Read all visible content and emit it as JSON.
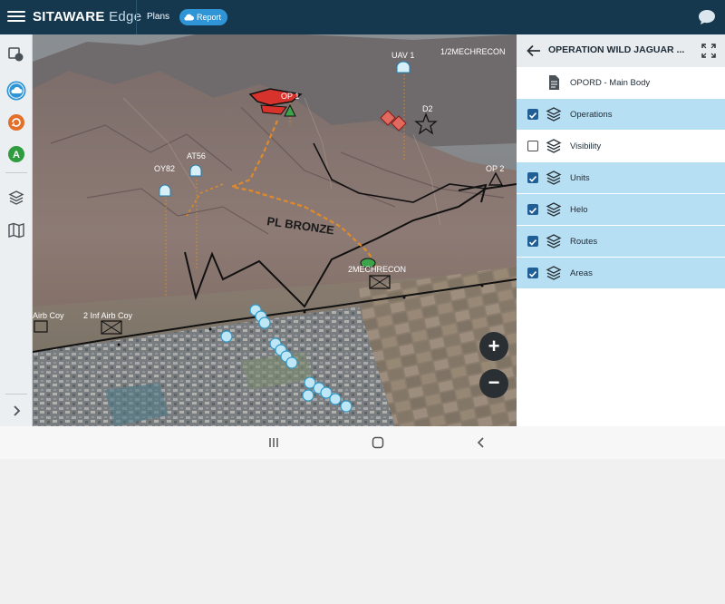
{
  "header": {
    "brand_bold": "SITAWARE",
    "brand_light": " Edge",
    "plans_label": "Plans",
    "report_label": "Report"
  },
  "leftbar": {
    "icons": [
      "layers-shapes-icon",
      "cloud-icon",
      "refresh-orange-icon",
      "letter-a-green-icon",
      "layers-icon",
      "map-book-icon",
      "chevron-right-icon"
    ],
    "badge_a": "A"
  },
  "map": {
    "labels": {
      "uav1": "UAV 1",
      "mechrecon_top": "1/2MECHRECON",
      "op1": "OP 1",
      "d2": "D2",
      "at56": "AT56",
      "oy82": "OY82",
      "op2": "OP 2",
      "pl_bronze": "PL BRONZE",
      "mechrecon_mid": "2MECHRECON",
      "airb_coy_1": "Airb Coy",
      "airb_coy_2": "2 Inf Airb Coy"
    },
    "zoom_in": "+",
    "zoom_out": "−"
  },
  "panel": {
    "title": "OPERATION WILD JAGUAR ...",
    "rows": [
      {
        "label": "OPORD - Main Body",
        "type": "doc",
        "checked": null
      },
      {
        "label": "Operations",
        "type": "layer",
        "checked": true
      },
      {
        "label": "Visibility",
        "type": "layer",
        "checked": false
      },
      {
        "label": "Units",
        "type": "layer",
        "checked": true
      },
      {
        "label": "Helo",
        "type": "layer",
        "checked": true
      },
      {
        "label": "Routes",
        "type": "layer",
        "checked": true
      },
      {
        "label": "Areas",
        "type": "layer",
        "checked": true
      }
    ]
  },
  "colors": {
    "header_bg": "#15384f",
    "accent_blue": "#2f95d6",
    "row_selected": "#b7dff3",
    "checkbox": "#1f5f96"
  }
}
